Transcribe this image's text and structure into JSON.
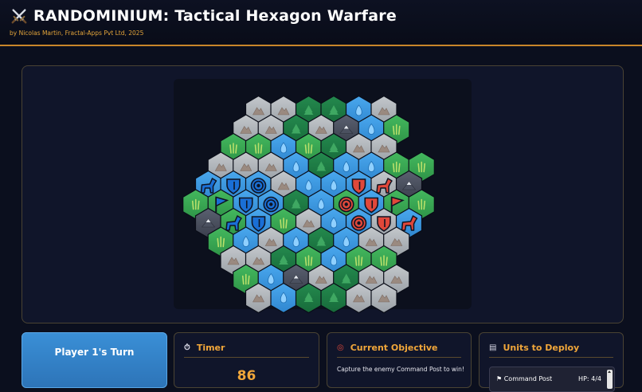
{
  "header": {
    "title": "RANDOMINIUM: Tactical Hexagon Warfare",
    "byline": "by Nicolas Martin, Fractal-Apps Pvt Ltd, 2025",
    "icon": "crossed-swords-icon"
  },
  "colors": {
    "header_rule": "#c8862a",
    "accent": "#f0a63a",
    "player1": "#1a6fd6",
    "player2": "#e0483a",
    "water": "#3a9be0",
    "forest": "#1f7a45",
    "grass": "#3aab55",
    "mountain": "#b4b8bc",
    "snow_peak": "#4a4f5e"
  },
  "board": {
    "columns": 10,
    "rows": 11,
    "legend": {
      "M": "mountain",
      "W": "water",
      "F": "forest",
      "G": "grass",
      "S": "snow-peak",
      "X": "empty"
    },
    "terrain": [
      "XXXMMFFWMX",
      "XXMMFMSWGX",
      "XXGGWGFMMX",
      "XMMMWFWWGG",
      "XWWWMWWWMS",
      "GGWWFWGWGG",
      "XSGWGMWWMW",
      "XGWMWFWMMX",
      "XXMMFGWGGX",
      "XXGWSMFMMX",
      "XXXMWFFMMX"
    ],
    "units": [
      {
        "row": 4,
        "col": 1,
        "type": "cavalry",
        "owner": "player1"
      },
      {
        "row": 4,
        "col": 2,
        "type": "shield",
        "owner": "player1"
      },
      {
        "row": 4,
        "col": 3,
        "type": "target",
        "owner": "player1"
      },
      {
        "row": 5,
        "col": 1,
        "type": "flag",
        "owner": "player1"
      },
      {
        "row": 5,
        "col": 2,
        "type": "shield",
        "owner": "player1"
      },
      {
        "row": 5,
        "col": 3,
        "type": "target",
        "owner": "player1"
      },
      {
        "row": 6,
        "col": 2,
        "type": "cavalry",
        "owner": "player1"
      },
      {
        "row": 6,
        "col": 3,
        "type": "shield",
        "owner": "player1"
      },
      {
        "row": 4,
        "col": 7,
        "type": "shield",
        "owner": "player2"
      },
      {
        "row": 4,
        "col": 8,
        "type": "cavalry",
        "owner": "player2"
      },
      {
        "row": 5,
        "col": 6,
        "type": "target",
        "owner": "player2"
      },
      {
        "row": 5,
        "col": 7,
        "type": "shield",
        "owner": "player2"
      },
      {
        "row": 5,
        "col": 8,
        "type": "flag",
        "owner": "player2"
      },
      {
        "row": 6,
        "col": 7,
        "type": "target",
        "owner": "player2"
      },
      {
        "row": 6,
        "col": 8,
        "type": "shield",
        "owner": "player2"
      },
      {
        "row": 6,
        "col": 9,
        "type": "cavalry",
        "owner": "player2"
      }
    ]
  },
  "turn": {
    "label": "Player 1's Turn"
  },
  "timer": {
    "title": "Timer",
    "icon": "stopwatch-icon",
    "value": "86"
  },
  "objective": {
    "title": "Current Objective",
    "icon": "target-icon",
    "text": "Capture the enemy Command Post to win!"
  },
  "deploy": {
    "title": "Units to Deploy",
    "icon": "scroll-icon",
    "units": [
      {
        "icon": "flag-icon",
        "name": "Command Post",
        "hp": "HP: 4/4"
      }
    ]
  }
}
